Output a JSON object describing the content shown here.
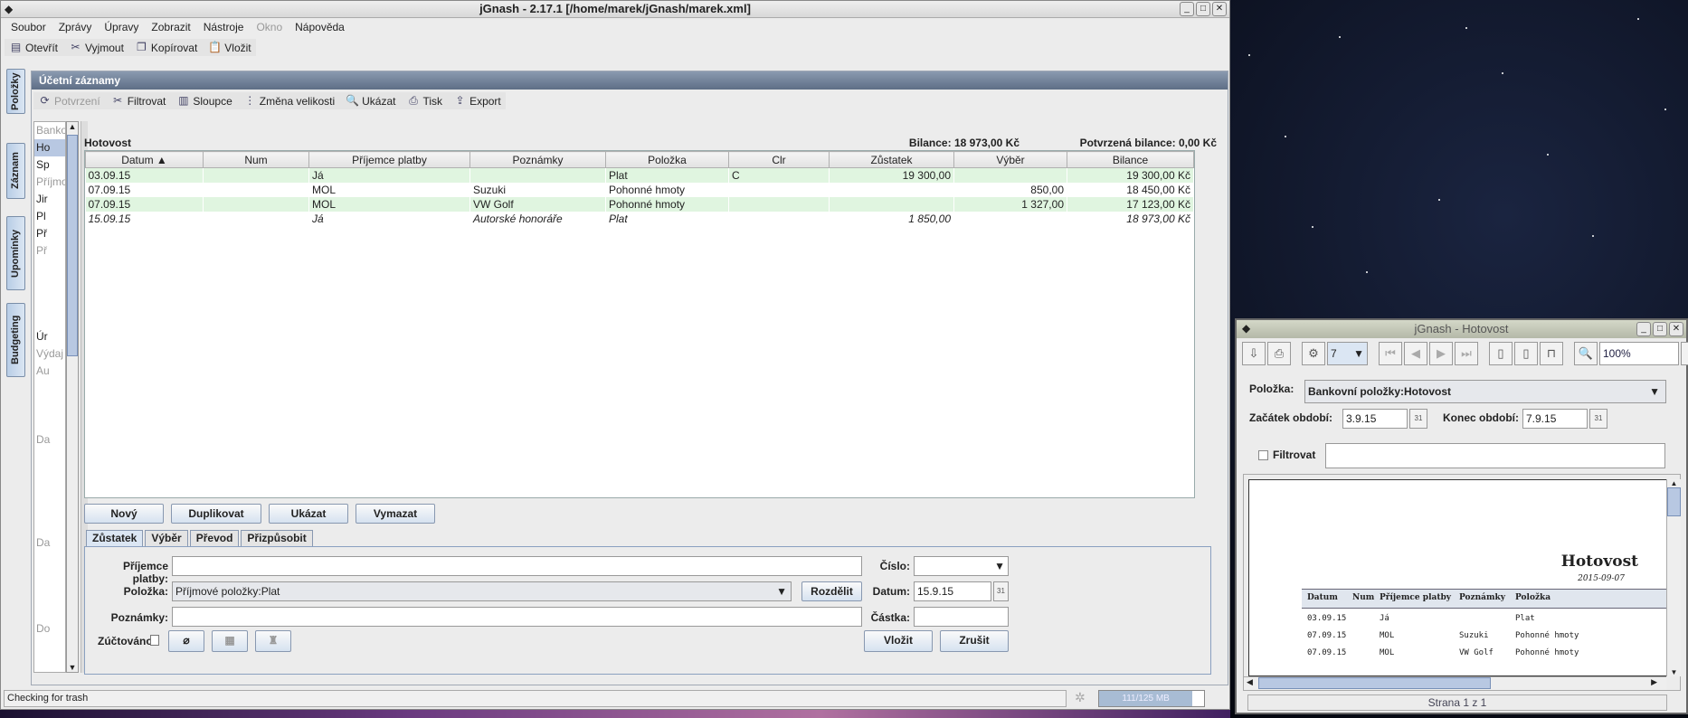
{
  "main_window": {
    "title": "jGnash - 2.17.1  [/home/marek/jGnash/marek.xml]"
  },
  "menu": [
    "Soubor",
    "Zprávy",
    "Úpravy",
    "Zobrazit",
    "Nástroje",
    "Okno",
    "Nápověda"
  ],
  "toolbar": [
    {
      "label": "Otevřít",
      "icon": "open-icon"
    },
    {
      "label": "Vyjmout",
      "icon": "cut-icon"
    },
    {
      "label": "Kopírovat",
      "icon": "copy-icon"
    },
    {
      "label": "Vložit",
      "icon": "paste-icon"
    }
  ],
  "side_tabs": [
    "Položky",
    "Záznam",
    "Upomínky",
    "Budgeting"
  ],
  "register": {
    "title": "Účetní záznamy",
    "toolbar": [
      "Potvrzení",
      "Filtrovat",
      "Sloupce",
      "Změna velikosti",
      "Ukázat",
      "Tisk",
      "Export"
    ],
    "tree": [
      "Banko",
      "Ho",
      "Sp",
      "Příjmo",
      "Jir",
      "Pl",
      "Př",
      "Př",
      "",
      "",
      "",
      "",
      "Úr",
      "Výdaj",
      "Au",
      "",
      "",
      "",
      "Da",
      "",
      "",
      "",
      "",
      "",
      "Da",
      "",
      "",
      "",
      "",
      "Do",
      ""
    ],
    "account": "Hotovost",
    "balance_label": "Bilance:",
    "balance": "18 973,00 Kč",
    "confirmed_label": "Potvrzená bilance:",
    "confirmed": "0,00 Kč",
    "columns": [
      "Datum ▲",
      "Num",
      "Příjemce platby",
      "Poznámky",
      "Položka",
      "Clr",
      "Zůstatek",
      "Výběr",
      "Bilance"
    ],
    "rows": [
      [
        "03.09.15",
        "",
        "Já",
        "",
        "Plat",
        "C",
        "19 300,00",
        "",
        "19 300,00 Kč"
      ],
      [
        "07.09.15",
        "",
        "MOL",
        "Suzuki",
        "Pohonné hmoty",
        "",
        "",
        "850,00",
        "18 450,00 Kč"
      ],
      [
        "07.09.15",
        "",
        "MOL",
        "VW Golf",
        "Pohonné hmoty",
        "",
        "",
        "1 327,00",
        "17 123,00 Kč"
      ],
      [
        "15.09.15",
        "",
        "Já",
        "Autorské honoráře",
        "Plat",
        "",
        "1 850,00",
        "",
        "18 973,00 Kč"
      ]
    ],
    "buttons": [
      "Nový",
      "Duplikovat",
      "Ukázat",
      "Vymazat"
    ],
    "tabs": [
      "Zůstatek",
      "Výběr",
      "Převod",
      "Přizpůsobit"
    ],
    "form": {
      "payee_label": "Příjemce platby:",
      "payee": "",
      "account_label": "Položka:",
      "account": "Příjmové položky:Plat",
      "split": "Rozdělit",
      "memo_label": "Poznámky:",
      "memo": "",
      "number_label": "Číslo:",
      "number": "",
      "date_label": "Datum:",
      "date": "15.9.15",
      "amount_label": "Částka:",
      "amount": "",
      "reconciled_label": "Zúčtováno",
      "enter": "Vložit",
      "cancel": "Zrušit"
    }
  },
  "status": {
    "text": "Checking for trash",
    "memory": "111/125 MB"
  },
  "report_window": {
    "title": "jGnash - Hotovost",
    "page_number": "7",
    "zoom": "100%",
    "account_label": "Položka:",
    "account": "Bankovní položky:Hotovost",
    "start_label": "Začátek období:",
    "start": "3.9.15",
    "end_label": "Konec období:",
    "end": "7.9.15",
    "filter_label": "Filtrovat",
    "filter": "",
    "report_title": "Hotovost",
    "report_date": "2015-09-07",
    "columns": [
      "Datum",
      "Num",
      "Příjemce platby",
      "Poznámky",
      "Položka"
    ],
    "rows": [
      [
        "03.09.15",
        "",
        "Já",
        "",
        "Plat"
      ],
      [
        "07.09.15",
        "",
        "MOL",
        "Suzuki",
        "Pohonné hmoty"
      ],
      [
        "07.09.15",
        "",
        "MOL",
        "VW Golf",
        "Pohonné hmoty"
      ]
    ],
    "page_status": "Strana 1 z 1"
  }
}
